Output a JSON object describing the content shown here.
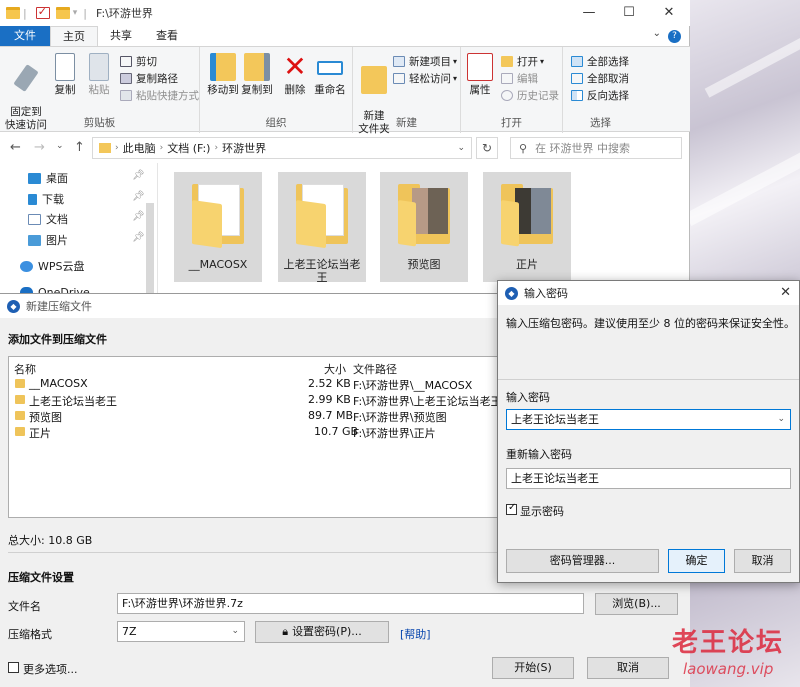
{
  "explorer": {
    "title": "F:\\环游世界",
    "tabs": [
      "文件",
      "主页",
      "共享",
      "查看"
    ],
    "ribbon": {
      "clipboard": {
        "label": "剪贴板",
        "pin": "固定到\n快速访问",
        "copy": "复制",
        "paste": "粘贴",
        "cut": "剪切",
        "copy_path": "复制路径",
        "paste_shortcut": "粘贴快捷方式"
      },
      "organize": {
        "label": "组织",
        "move_to": "移动到",
        "copy_to": "复制到",
        "delete": "删除",
        "rename": "重命名"
      },
      "new": {
        "label": "新建",
        "new_folder": "新建\n文件夹",
        "new_item": "新建项目",
        "easy_access": "轻松访问"
      },
      "open": {
        "label": "打开",
        "properties": "属性",
        "open": "打开",
        "edit": "编辑",
        "history": "历史记录"
      },
      "select": {
        "label": "选择",
        "select_all": "全部选择",
        "select_none": "全部取消",
        "invert": "反向选择"
      }
    },
    "address": [
      "此电脑",
      "文档 (F:)",
      "环游世界"
    ],
    "search_placeholder": "在 环游世界 中搜索",
    "nav_items": [
      "桌面",
      "下载",
      "文档",
      "图片",
      "WPS云盘",
      "OneDrive"
    ],
    "files": [
      "__MACOSX",
      "上老王论坛当老王",
      "预览图",
      "正片"
    ]
  },
  "compress": {
    "title": "新建压缩文件",
    "add_section": "添加文件到压缩文件",
    "columns": {
      "name": "名称",
      "size": "大小",
      "path": "文件路径"
    },
    "rows": [
      {
        "name": "__MACOSX",
        "size": "2.52 KB",
        "path": "F:\\环游世界\\__MACOSX"
      },
      {
        "name": "上老王论坛当老王",
        "size": "2.99 KB",
        "path": "F:\\环游世界\\上老王论坛当老王"
      },
      {
        "name": "预览图",
        "size": "89.7 MB",
        "path": "F:\\环游世界\\预览图"
      },
      {
        "name": "正片",
        "size": "10.7 GB",
        "path": "F:\\环游世界\\正片"
      }
    ],
    "total": "总大小: 10.8 GB",
    "settings_section": "压缩文件设置",
    "filename_label": "文件名",
    "filename_value": "F:\\环游世界\\环游世界.7z",
    "browse": "浏览(B)...",
    "format_label": "压缩格式",
    "format_value": "7Z",
    "set_password": "设置密码(P)...",
    "help": "[帮助]",
    "more_options": "更多选项...",
    "start": "开始(S)",
    "cancel": "取消"
  },
  "password": {
    "title": "输入密码",
    "hint": "输入压缩包密码。建议使用至少 8 位的密码来保证安全性。",
    "enter_label": "输入密码",
    "enter_value": "上老王论坛当老王",
    "reenter_label": "重新输入密码",
    "reenter_value": "上老王论坛当老王",
    "show_password": "显示密码",
    "manager": "密码管理器...",
    "ok": "确定",
    "cancel": "取消"
  },
  "watermark": {
    "brand": "老王论坛",
    "url": "laowang.vip"
  }
}
